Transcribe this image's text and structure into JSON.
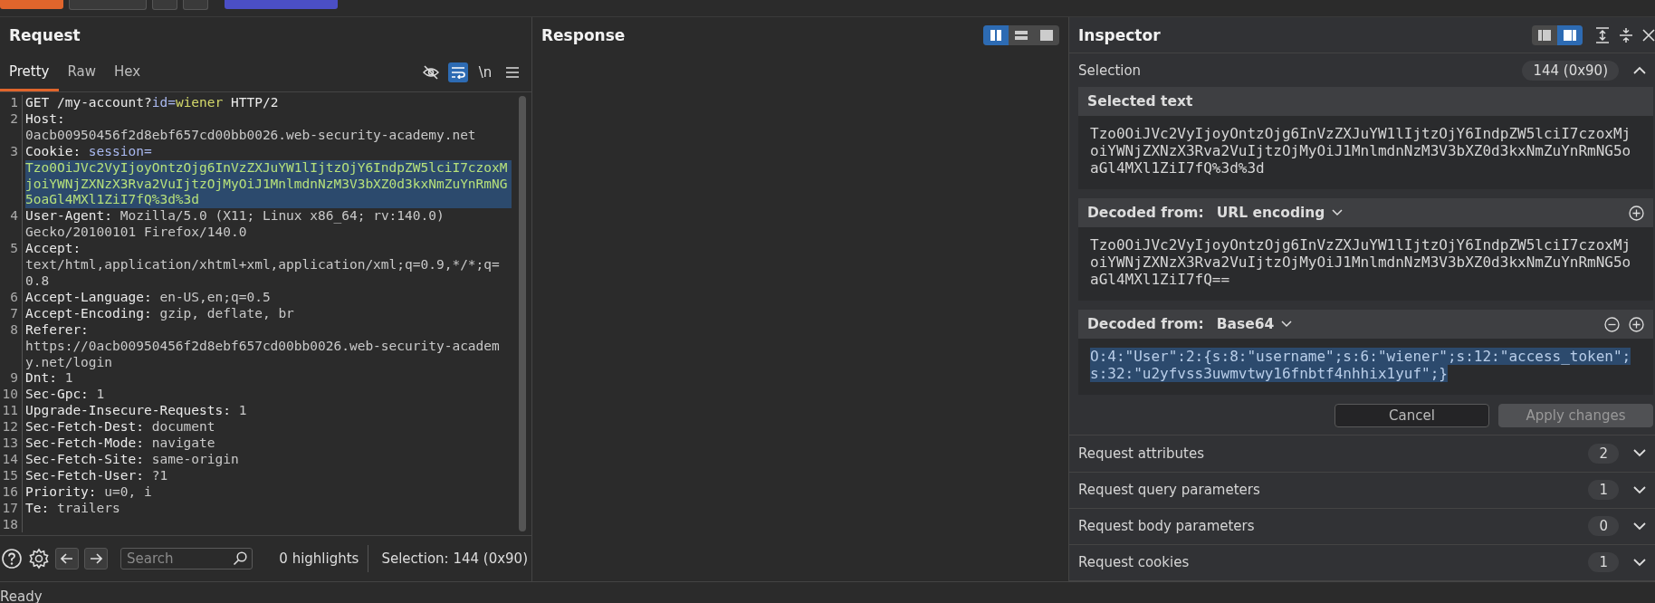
{
  "request": {
    "title": "Request",
    "tabs": [
      {
        "label": "Pretty",
        "selected": true
      },
      {
        "label": "Raw",
        "selected": false
      },
      {
        "label": "Hex",
        "selected": false
      }
    ],
    "tools": [
      {
        "kind": "hide",
        "selected": false
      },
      {
        "kind": "wrap",
        "selected": true
      },
      {
        "kind": "newline",
        "label": "\\n",
        "selected": false
      },
      {
        "kind": "menu",
        "selected": false
      }
    ],
    "lines": [
      {
        "number": "1",
        "segments": [
          {
            "kind": "plain",
            "text": "GET /my-account?"
          },
          {
            "kind": "param-name",
            "text": "id="
          },
          {
            "kind": "param-value",
            "text": "wiener"
          },
          {
            "kind": "plain",
            "text": " HTTP/2"
          }
        ]
      },
      {
        "number": "2",
        "segments": [
          {
            "kind": "plain",
            "text": "Host:"
          },
          {
            "kind": "value",
            "text": " 0acb00950456f2d8ebf657cd00bb0026.web-security-academy.net"
          }
        ]
      },
      {
        "number": "3",
        "segments": [
          {
            "kind": "plain",
            "text": "Cookie: "
          },
          {
            "kind": "param-name",
            "text": "session="
          },
          {
            "kind": "selected",
            "text": "Tzo0OiJVc2VyIjoyOntzOjg6InVzZXJuYW1lIjtzOjY6IndpZW5lciI7czoxMjoiYWNjZXNzX3Rva2VuIjtzOjMyOiJ1MnlmdnNzM3V3bXZ0d3kxNmZuYnRmNG5oaGl4MXl1ZiI7fQ%3d%3d"
          }
        ]
      },
      {
        "number": "4",
        "segments": [
          {
            "kind": "plain",
            "text": "User-Agent:"
          },
          {
            "kind": "value",
            "text": " Mozilla/5.0 (X11; Linux x86_64; rv:140.0) Gecko/20100101 Firefox/140.0"
          }
        ]
      },
      {
        "number": "5",
        "segments": [
          {
            "kind": "plain",
            "text": "Accept:"
          },
          {
            "kind": "value",
            "text": " text/html,application/xhtml+xml,application/xml;q=0.9,*/*;q=0.8"
          }
        ]
      },
      {
        "number": "6",
        "segments": [
          {
            "kind": "plain",
            "text": "Accept-Language:"
          },
          {
            "kind": "value",
            "text": " en-US,en;q=0.5"
          }
        ]
      },
      {
        "number": "7",
        "segments": [
          {
            "kind": "plain",
            "text": "Accept-Encoding:"
          },
          {
            "kind": "value",
            "text": " gzip, deflate, br"
          }
        ]
      },
      {
        "number": "8",
        "segments": [
          {
            "kind": "plain",
            "text": "Referer:"
          },
          {
            "kind": "value",
            "text": " https://0acb00950456f2d8ebf657cd00bb0026.web-security-academy.net/login"
          }
        ]
      },
      {
        "number": "9",
        "segments": [
          {
            "kind": "plain",
            "text": "Dnt:"
          },
          {
            "kind": "value",
            "text": " 1"
          }
        ]
      },
      {
        "number": "10",
        "segments": [
          {
            "kind": "plain",
            "text": "Sec-Gpc:"
          },
          {
            "kind": "value",
            "text": " 1"
          }
        ]
      },
      {
        "number": "11",
        "segments": [
          {
            "kind": "plain",
            "text": "Upgrade-Insecure-Requests:"
          },
          {
            "kind": "value",
            "text": " 1"
          }
        ]
      },
      {
        "number": "12",
        "segments": [
          {
            "kind": "plain",
            "text": "Sec-Fetch-Dest:"
          },
          {
            "kind": "value",
            "text": " document"
          }
        ]
      },
      {
        "number": "13",
        "segments": [
          {
            "kind": "plain",
            "text": "Sec-Fetch-Mode:"
          },
          {
            "kind": "value",
            "text": " navigate"
          }
        ]
      },
      {
        "number": "14",
        "segments": [
          {
            "kind": "plain",
            "text": "Sec-Fetch-Site:"
          },
          {
            "kind": "value",
            "text": " same-origin"
          }
        ]
      },
      {
        "number": "15",
        "segments": [
          {
            "kind": "plain",
            "text": "Sec-Fetch-User:"
          },
          {
            "kind": "value",
            "text": " ?1"
          }
        ]
      },
      {
        "number": "16",
        "segments": [
          {
            "kind": "plain",
            "text": "Priority:"
          },
          {
            "kind": "value",
            "text": " u=0, i"
          }
        ]
      },
      {
        "number": "17",
        "segments": [
          {
            "kind": "plain",
            "text": "Te:"
          },
          {
            "kind": "value",
            "text": " trailers"
          }
        ]
      },
      {
        "number": "18"
      }
    ],
    "search": {
      "placeholder": "Search"
    },
    "highlights": "0 highlights",
    "selection": "Selection: 144 (0x90)"
  },
  "response": {
    "title": "Response",
    "layouts": [
      {
        "kind": "columns",
        "selected": true
      },
      {
        "kind": "rows",
        "selected": false
      },
      {
        "kind": "single",
        "selected": false
      }
    ]
  },
  "inspector": {
    "title": "Inspector",
    "layouts": [
      {
        "kind": "left",
        "selected": false
      },
      {
        "kind": "right",
        "selected": true
      }
    ],
    "selection": {
      "label": "Selection",
      "count": "144 (0x90)",
      "expanded": true,
      "selected_text": {
        "title": "Selected text",
        "text": "Tzo0OiJVc2VyIjoyOntzOjg6InVzZXJuYW1lIjtzOjY6IndpZW5lciI7czoxMjoiYWNjZXNzX3Rva2VuIjtzOjMyOiJ1MnlmdnNzM3V3bXZ0d3kxNmZuYnRmNG5oaGl4MXl1ZiI7fQ%3d%3d"
      },
      "decoded": [
        {
          "label": "Decoded from:",
          "encoding": "URL encoding",
          "removable": false,
          "highlighted": false,
          "text": "Tzo0OiJVc2VyIjoyOntzOjg6InVzZXJuYW1lIjtzOjY6IndpZW5lciI7czoxMjoiYWNjZXNzX3Rva2VuIjtzOjMyOiJ1MnlmdnNzM3V3bXZ0d3kxNmZuYnRmNG5oaGl4MXl1ZiI7fQ=="
        },
        {
          "label": "Decoded from:",
          "encoding": "Base64",
          "removable": true,
          "highlighted": true,
          "text": "O:4:\"User\":2:{s:8:\"username\";s:6:\"wiener\";s:12:\"access_token\";s:32:\"u2yfvss3uwmvtwy16fnbtf4nhhix1yuf\";}"
        }
      ],
      "buttons": [
        {
          "label": "Cancel",
          "disabled": false
        },
        {
          "label": "Apply changes",
          "disabled": true
        }
      ]
    },
    "sections": [
      {
        "label": "Request attributes",
        "count": "2",
        "expanded": false
      },
      {
        "label": "Request query parameters",
        "count": "1",
        "expanded": false
      },
      {
        "label": "Request body parameters",
        "count": "0",
        "expanded": false
      },
      {
        "label": "Request cookies",
        "count": "1",
        "expanded": false
      }
    ]
  },
  "status_bar": {
    "text": "Ready"
  }
}
